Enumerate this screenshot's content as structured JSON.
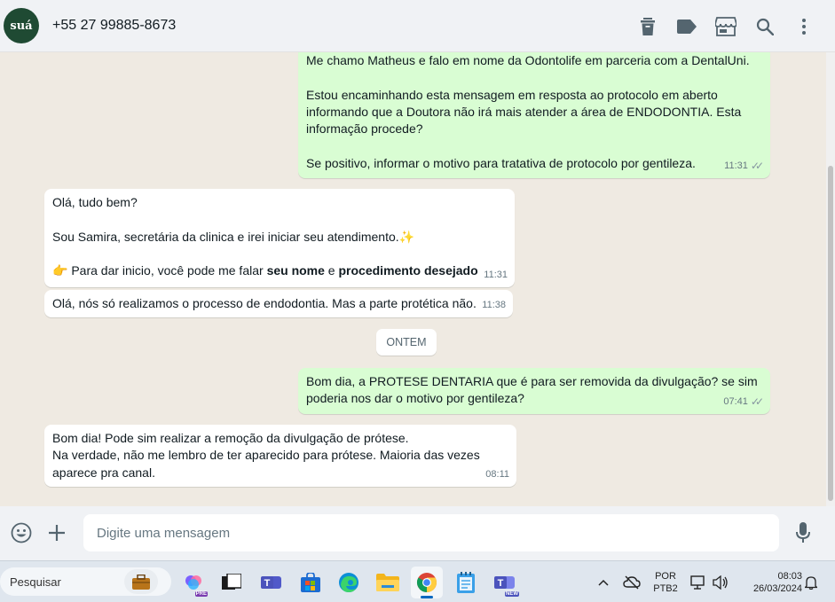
{
  "header": {
    "avatar_text": "suá",
    "contact_name": "+55 27 99885-8673",
    "icons": [
      "delete-icon",
      "label-icon",
      "store-icon",
      "search-icon",
      "menu-icon"
    ]
  },
  "messages": {
    "m1": {
      "direction": "out",
      "lines": [
        "Me chamo Matheus e falo em nome da Odontolife em parceria com a DentalUni.",
        "",
        "Estou encaminhando esta mensagem em resposta ao protocolo em aberto",
        "informando que a Doutora não irá mais atender a área de ENDODONTIA. Esta",
        "informação procede?",
        "",
        "Se positivo, informar o motivo para tratativa de protocolo por gentileza."
      ],
      "time": "11:31"
    },
    "m2": {
      "direction": "in",
      "line1": "Olá, tudo bem?",
      "line2": "Sou Samira, secretária da clinica e irei iniciar seu atendimento.",
      "line2_emoji": "✨",
      "line3_emoji": "👉",
      "line3_a": " Para dar inicio, você pode me falar ",
      "line3_b": "seu nome",
      "line3_c": " e ",
      "line3_d": "procedimento desejado",
      "time": "11:31"
    },
    "m3": {
      "direction": "in",
      "text": "Olá, nós só realizamos o processo de endodontia. Mas a parte protética não.",
      "time": "11:38"
    },
    "date_divider": "ONTEM",
    "m4": {
      "direction": "out",
      "lines": [
        "Bom dia, a PROTESE DENTARIA que é para ser removida da divulgação? se sim",
        "poderia nos dar o motivo por gentileza?"
      ],
      "time": "07:41"
    },
    "m5": {
      "direction": "in",
      "lines": [
        "Bom dia! Pode sim realizar a remoção da divulgação de prótese.",
        "Na verdade, não me lembro de ter aparecido para prótese. Maioria das vezes",
        "aparece pra canal."
      ],
      "time": "08:11"
    }
  },
  "composer": {
    "placeholder": "Digite uma mensagem",
    "icons": [
      "emoji-icon",
      "plus-icon",
      "microphone-icon"
    ]
  },
  "taskbar": {
    "search_label": "Pesquisar",
    "language_line1": "POR",
    "language_line2": "PTB2",
    "clock_time": "08:03",
    "clock_date": "26/03/2024",
    "copilot_badge": "PRE",
    "teams_badge": "NEW"
  },
  "colors": {
    "outgoing_bubble": "#d9fdd3",
    "incoming_bubble": "#ffffff",
    "chat_background": "#efeae2",
    "header_background": "#f0f2f5"
  }
}
